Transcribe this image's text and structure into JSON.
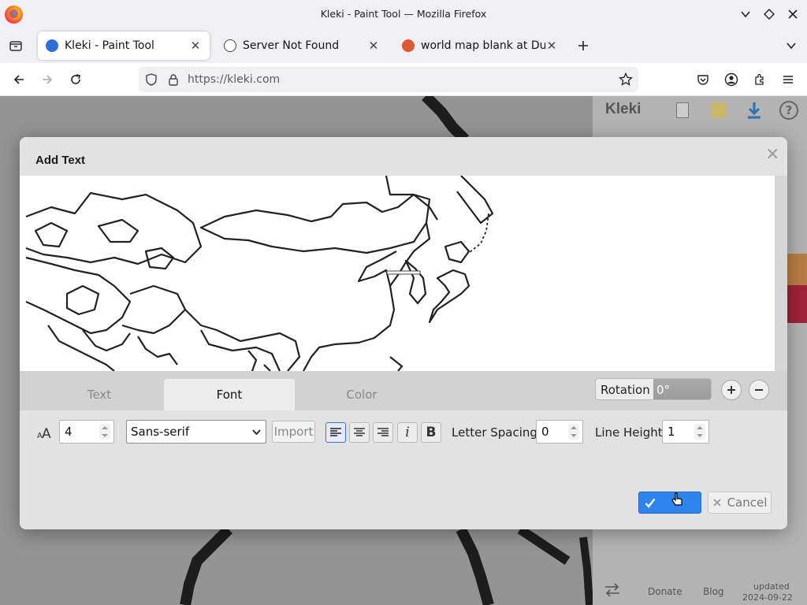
{
  "window": {
    "title": "Kleki - Paint Tool — Mozilla Firefox"
  },
  "tabs": [
    {
      "label": "Kleki - Paint Tool",
      "icon": "kleki-favicon",
      "active": true
    },
    {
      "label": "Server Not Found",
      "icon": "info-icon",
      "active": false
    },
    {
      "label": "world map blank at DuckDuckGo",
      "icon": "duckduckgo-favicon",
      "active": false
    }
  ],
  "navbar": {
    "url": "https://kleki.com"
  },
  "app": {
    "logo": "Kleki",
    "footer": {
      "donate": "Donate",
      "blog": "Blog",
      "updated_label": "updated",
      "updated_date": "2024-09-22"
    }
  },
  "dialog": {
    "title": "Add Text",
    "close": "×",
    "tabs": [
      "Text",
      "Font",
      "Color"
    ],
    "active_tab": "Font",
    "rotation": {
      "label": "Rotation",
      "value": "0°"
    },
    "font": {
      "size_icon": "font-size-icon",
      "size_value": "4",
      "family_value": "Sans-serif",
      "import_label": "Import",
      "alignments": [
        "align-left",
        "align-center",
        "align-right"
      ],
      "selected_alignment": "align-left",
      "italic_label": "i",
      "bold_label": "B",
      "letter_spacing_label": "Letter Spacing",
      "letter_spacing_value": "0",
      "line_height_label": "Line Height",
      "line_height_value": "1"
    },
    "ok_icon": "checkmark-icon",
    "cancel_label": "Cancel",
    "accent_color": "#2f85f0"
  }
}
